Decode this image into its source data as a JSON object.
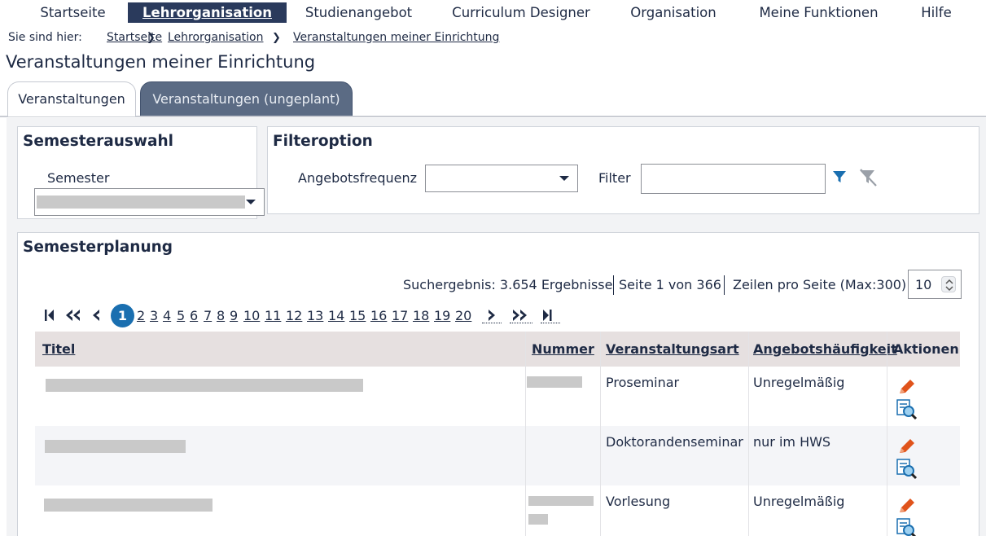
{
  "nav": {
    "items": [
      {
        "label": "Startseite",
        "active": false
      },
      {
        "label": "Lehrorganisation",
        "active": true
      },
      {
        "label": "Studienangebot",
        "active": false
      },
      {
        "label": "Curriculum Designer",
        "active": false
      },
      {
        "label": "Organisation",
        "active": false
      },
      {
        "label": "Meine Funktionen",
        "active": false
      },
      {
        "label": "Hilfe",
        "active": false
      }
    ]
  },
  "breadcrumb": {
    "prefix": "Sie sind hier:",
    "items": [
      "Startseite",
      "Lehrorganisation",
      "Veranstaltungen meiner Einrichtung"
    ]
  },
  "page_title": "Veranstaltungen meiner Einrichtung",
  "tabs": [
    {
      "label": "Veranstaltungen"
    },
    {
      "label": "Veranstaltungen (ungeplant)"
    }
  ],
  "semester": {
    "title": "Semesterauswahl",
    "field_label": "Semester"
  },
  "filter": {
    "title": "Filteroption",
    "frequency_label": "Angebotsfrequenz",
    "frequency_value": "",
    "filter_label": "Filter",
    "filter_value": "",
    "icons": [
      "filter-icon",
      "clear-filter-icon"
    ]
  },
  "planning": {
    "title": "Semesterplanung",
    "result_text": "Suchergebnis: 3.654 Ergebnisse",
    "page_text": "Seite 1 von 366",
    "rows_label": "Zeilen pro Seite (Max:300)",
    "rows_value": "10",
    "current_page": "1",
    "pages": [
      "2",
      "3",
      "4",
      "5",
      "6",
      "7",
      "8",
      "9",
      "10",
      "11",
      "12",
      "13",
      "14",
      "15",
      "16",
      "17",
      "18",
      "19",
      "20"
    ]
  },
  "table": {
    "headers": [
      "Titel",
      "Nummer",
      "Veranstaltungsart",
      "Angebotshäufigkeit",
      "Aktionen"
    ],
    "rows": [
      {
        "art": "Proseminar",
        "frequency": "Unregelmäßig"
      },
      {
        "art": "Doktorandenseminar",
        "frequency": "nur im HWS"
      },
      {
        "art": "Vorlesung",
        "frequency": "Unregelmäßig"
      }
    ]
  },
  "colors": {
    "nav_active": "#2a3a5c",
    "tab_dark": "#5b6b84",
    "page_current": "#1a6fb0",
    "filter_icon": "#1a6fb0",
    "edit_icon": "#e0531b"
  }
}
